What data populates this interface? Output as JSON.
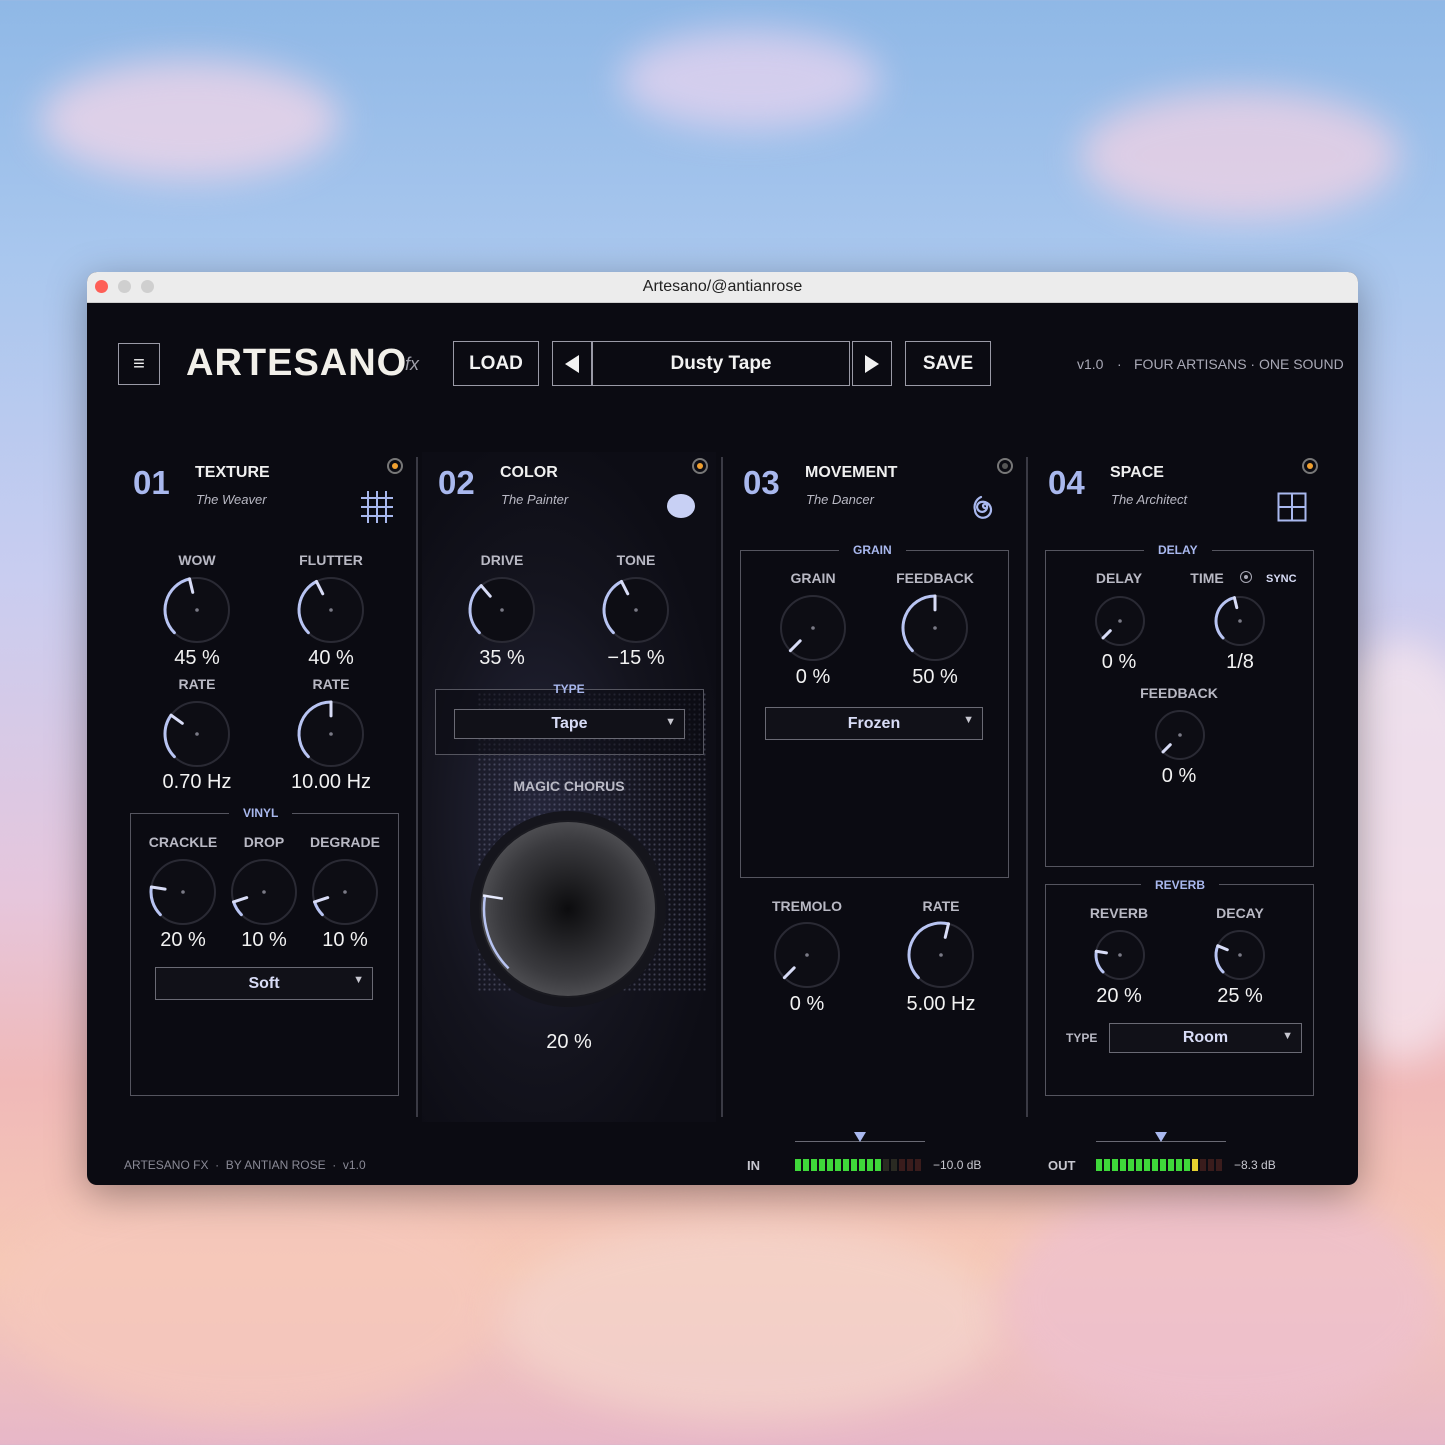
{
  "window": {
    "title": "Artesano/@antianrose"
  },
  "header": {
    "brand": "ARTESANO",
    "brand_suffix": "fx",
    "load_label": "LOAD",
    "prev_icon": "triangle-left-icon",
    "preset_name": "Dusty Tape",
    "next_icon": "triangle-right-icon",
    "save_label": "SAVE",
    "version": "v1.0",
    "separator": "·",
    "tagline": "FOUR ARTISANS · ONE SOUND"
  },
  "sections": [
    {
      "number": "01",
      "title": "TEXTURE",
      "subtitle": "The Weaver",
      "icon": "grid-icon",
      "power": "on",
      "knobs": [
        {
          "label": "WOW",
          "value": "45 %",
          "fraction": 0.45
        },
        {
          "label": "FLUTTER",
          "value": "40 %",
          "fraction": 0.4
        },
        {
          "label": "RATE",
          "value": "0.70 Hz",
          "fraction": 0.3
        },
        {
          "label": "RATE",
          "value": "10.00 Hz",
          "fraction": 0.5
        }
      ],
      "vinyl": {
        "title": "VINYL",
        "knobs": [
          {
            "label": "CRACKLE",
            "value": "20 %",
            "fraction": 0.2
          },
          {
            "label": "DROP",
            "value": "10 %",
            "fraction": 0.1
          },
          {
            "label": "DEGRADE",
            "value": "10 %",
            "fraction": 0.1
          }
        ],
        "mode": "Soft"
      }
    },
    {
      "number": "02",
      "title": "COLOR",
      "subtitle": "The Painter",
      "icon": "paint-blob-icon",
      "power": "on",
      "knobs": [
        {
          "label": "DRIVE",
          "value": "35 %",
          "fraction": 0.35
        },
        {
          "label": "TONE",
          "value": "−15 %",
          "fraction": 0.4
        }
      ],
      "type_label": "TYPE",
      "type_value": "Tape",
      "chorus_label": "MAGIC CHORUS",
      "chorus_value": "20 %",
      "chorus_fraction": 0.2
    },
    {
      "number": "03",
      "title": "MOVEMENT",
      "subtitle": "The Dancer",
      "icon": "spiral-icon",
      "power": "off",
      "grain": {
        "title": "GRAIN",
        "knobs": [
          {
            "label": "GRAIN",
            "value": "0 %",
            "fraction": 0.0
          },
          {
            "label": "FEEDBACK",
            "value": "50 %",
            "fraction": 0.5
          }
        ],
        "mode": "Frozen"
      },
      "knobs": [
        {
          "label": "TREMOLO",
          "value": "0 %",
          "fraction": 0.0
        },
        {
          "label": "RATE",
          "value": "5.00 Hz",
          "fraction": 0.55
        }
      ]
    },
    {
      "number": "04",
      "title": "SPACE",
      "subtitle": "The Architect",
      "icon": "window-grid-icon",
      "power": "on",
      "delay": {
        "title": "DELAY",
        "sync_label": "SYNC",
        "knobs": [
          {
            "label": "DELAY",
            "value": "0 %",
            "fraction": 0.0
          },
          {
            "label": "TIME",
            "value": "1/8",
            "fraction": 0.45
          },
          {
            "label": "FEEDBACK",
            "value": "0 %",
            "fraction": 0.0
          }
        ]
      },
      "reverb": {
        "title": "REVERB",
        "knobs": [
          {
            "label": "REVERB",
            "value": "20 %",
            "fraction": 0.2
          },
          {
            "label": "DECAY",
            "value": "25 %",
            "fraction": 0.25
          }
        ],
        "type_label": "TYPE",
        "type_value": "Room"
      }
    }
  ],
  "footer": {
    "credit": "ARTESANO FX  ·  BY ANTIAN ROSE  ·  v1.0",
    "in_label": "IN",
    "in_db": "−10.0 dB",
    "in_level": 0.7,
    "out_label": "OUT",
    "out_db": "−8.3 dB",
    "out_level": 0.8
  },
  "colors": {
    "accent": "#a9b8ee",
    "power_on": "#f0a030",
    "background": "#0b0b12",
    "meter_green": "#3fd93a",
    "meter_yellow": "#e6d230"
  }
}
